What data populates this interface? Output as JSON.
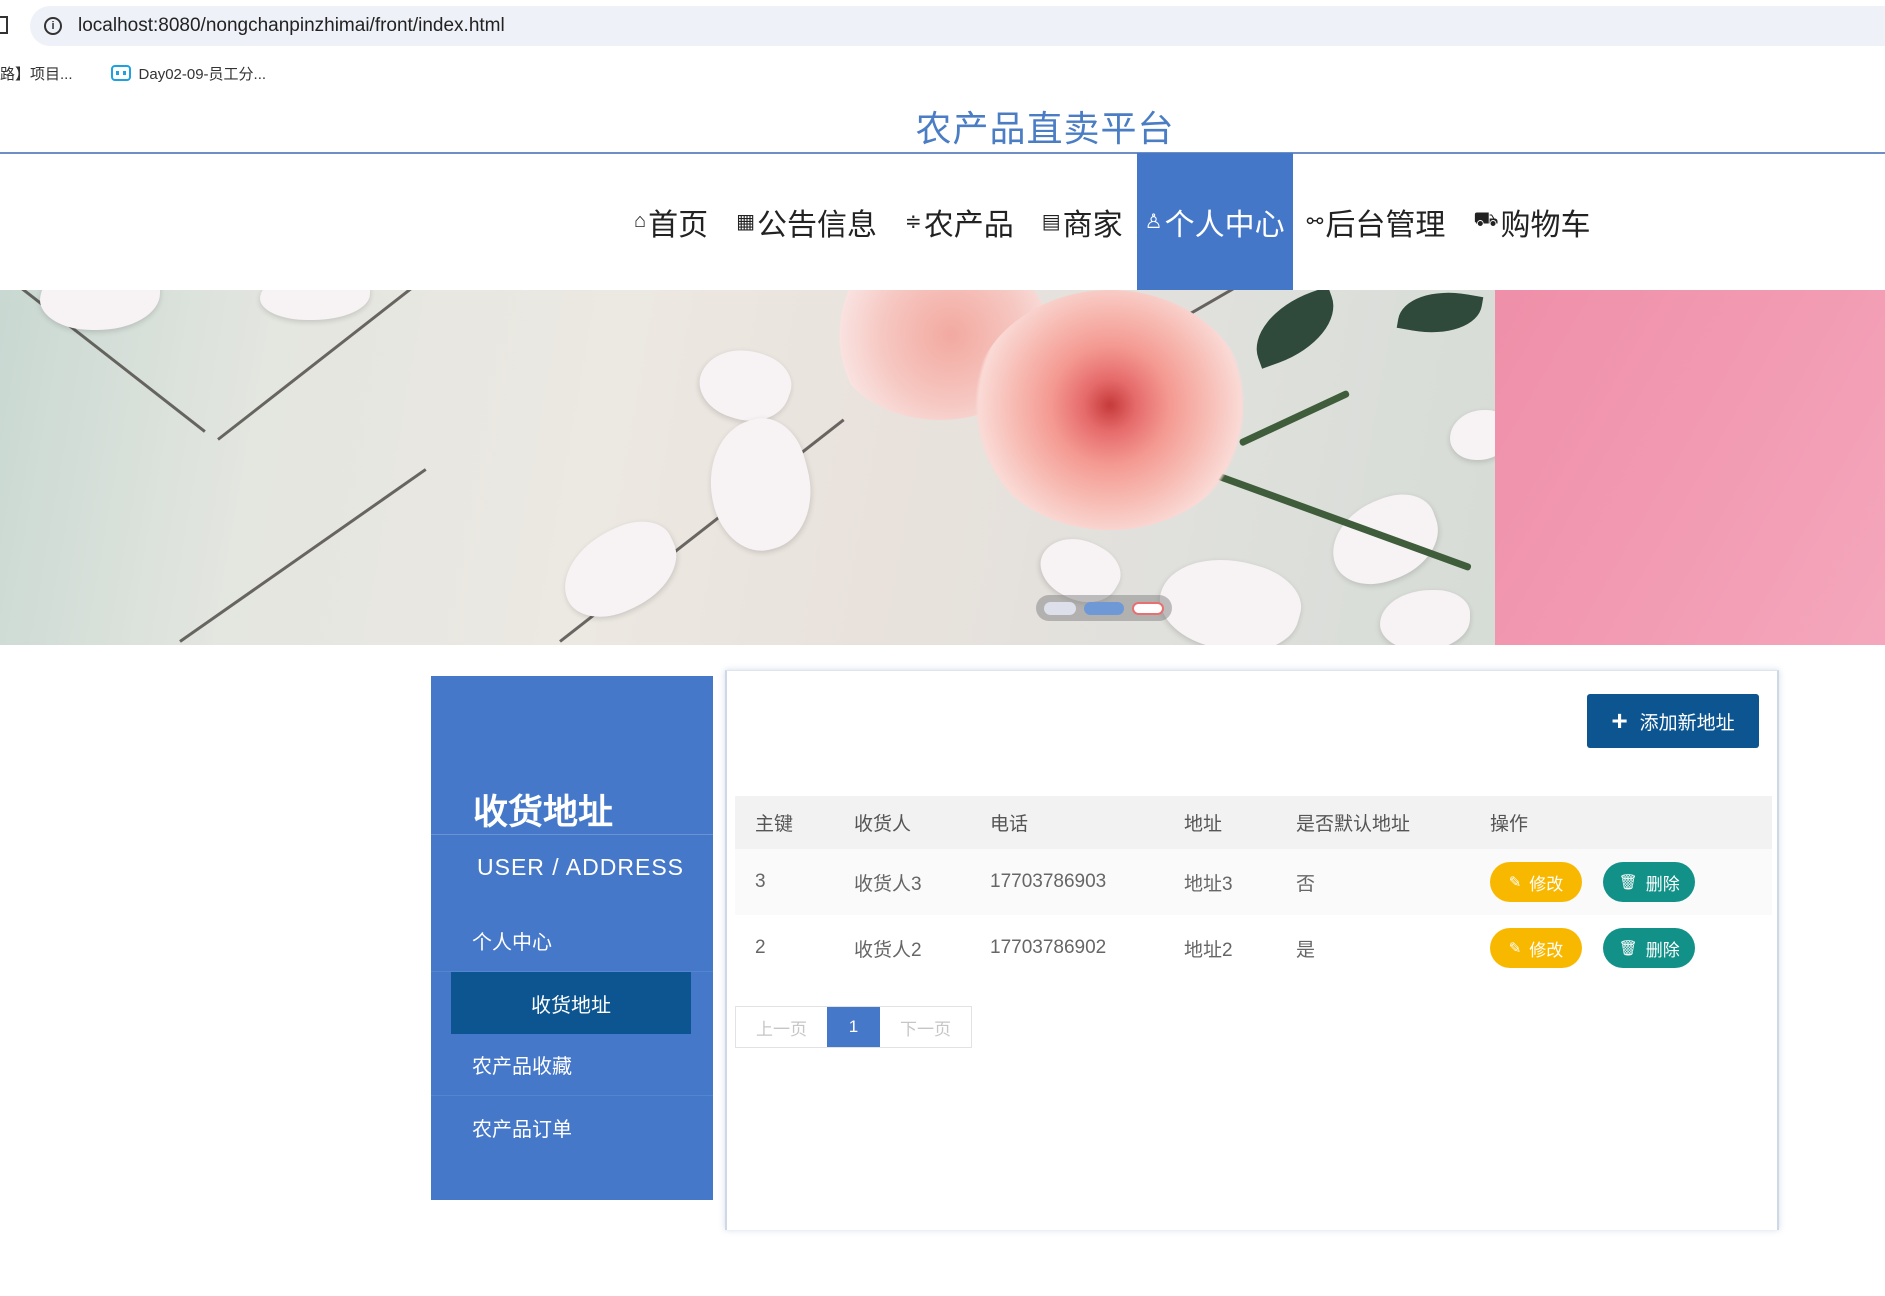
{
  "browser": {
    "url": "localhost:8080/nongchanpinzhimai/front/index.html",
    "bookmarks": [
      "路】项目...",
      "Day02-09-员工分..."
    ]
  },
  "header": {
    "site_title": "农产品直卖平台",
    "nav": [
      {
        "icon": "⌂",
        "label": "首页"
      },
      {
        "icon": "▦",
        "label": "公告信息"
      },
      {
        "icon": "≑",
        "label": "农产品"
      },
      {
        "icon": "▤",
        "label": "商家"
      },
      {
        "icon": "♙",
        "label": "个人中心"
      },
      {
        "icon": "⚯",
        "label": "后台管理"
      },
      {
        "icon": "⛟",
        "label": "购物车"
      }
    ],
    "active_nav": "个人中心"
  },
  "carousel": {
    "slides": 3,
    "active_index": 1
  },
  "sidebar": {
    "title": "收货地址",
    "subtitle": "USER / ADDRESS",
    "items": [
      "个人中心",
      "收货地址",
      "农产品收藏",
      "农产品订单"
    ],
    "active_item": "收货地址"
  },
  "main": {
    "add_button": "添加新地址",
    "table": {
      "headers": [
        "主键",
        "收货人",
        "电话",
        "地址",
        "是否默认地址",
        "操作"
      ],
      "rows": [
        {
          "id": "3",
          "name": "收货人3",
          "phone": "17703786903",
          "address": "地址3",
          "is_default": "否"
        },
        {
          "id": "2",
          "name": "收货人2",
          "phone": "17703786902",
          "address": "地址2",
          "is_default": "是"
        }
      ],
      "edit_label": "修改",
      "delete_label": "删除"
    },
    "pagination": {
      "prev": "上一页",
      "current": "1",
      "next": "下一页"
    }
  },
  "colors": {
    "primary": "#4678c9",
    "dark_blue": "#0c5590",
    "edit": "#f9b800",
    "delete": "#119188",
    "title": "#4a7dc4"
  }
}
